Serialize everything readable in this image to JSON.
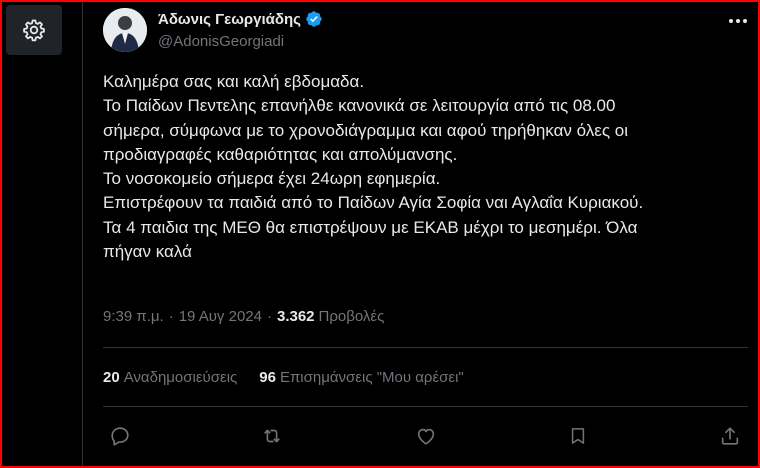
{
  "tweet": {
    "author": {
      "display_name": "Άδωνις Γεωργιάδης",
      "handle": "@AdonisGeorgiadi"
    },
    "text_lines": [
      "Καλημέρα σας και καλή εβδομαδα.",
      "Το Παίδων Πεντελης επανήλθε κανονικά σε λειτουργία από τις 08.00",
      "σήμερα, σύμφωνα με το χρονοδιάγραμμα και αφού τηρήθηκαν όλες οι",
      "προδιαγραφές καθαριότητας και απολύμανσης.",
      "Το νοσοκομείο σήμερα έχει 24ωρη εφημερία.",
      "Επιστρέφουν τα παιδιά από το Παίδων Αγία Σοφία ναι Αγλαΐα Κυριακού.",
      "Τα 4 παιδια της ΜΕΘ θα επιστρέψουν με ΕΚΑΒ μέχρι το μεσημέρι. Όλα",
      "πήγαν καλά"
    ],
    "meta": {
      "time": "9:39 π.μ.",
      "separator": "·",
      "date": "19 Αυγ 2024",
      "views_count": "3.362",
      "views_label": "Προβολές"
    },
    "stats": {
      "reposts_count": "20",
      "reposts_label": "Αναδημοσιεύσεις",
      "likes_count": "96",
      "likes_label": "Επισημάνσεις \"Μου αρέσει\""
    }
  },
  "icons": {
    "settings": "gear-icon",
    "verified": "verified-badge-icon",
    "more": "more-options-icon",
    "reply": "reply-icon",
    "repost": "repost-icon",
    "like": "heart-icon",
    "bookmark": "bookmark-icon",
    "share": "share-icon"
  },
  "colors": {
    "background": "#000000",
    "text_primary": "#e7e9ea",
    "text_secondary": "#71767b",
    "verified_blue": "#1d9bf0",
    "border": "#2f3336",
    "frame": "#ff0000"
  }
}
